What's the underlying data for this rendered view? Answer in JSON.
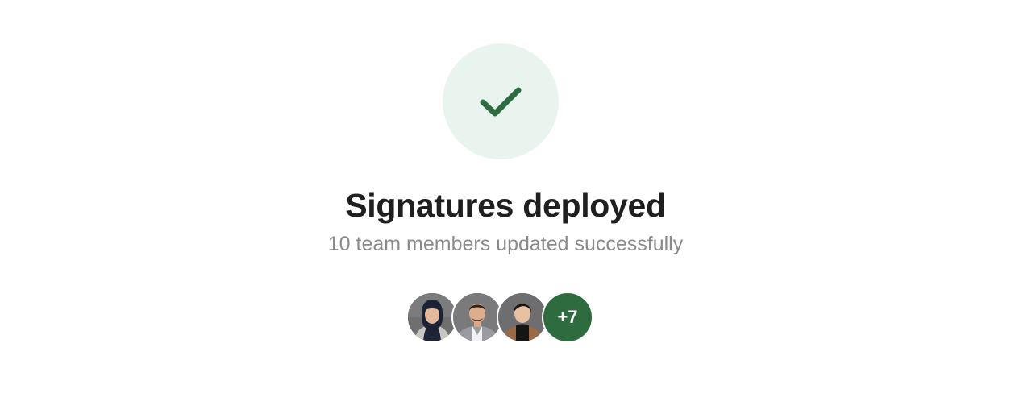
{
  "status": {
    "icon": "checkmark-icon",
    "accent_color": "#2e6b3f",
    "icon_bg_color": "#eaf4ee"
  },
  "title": "Signatures deployed",
  "subtitle": "10 team members updated successfully",
  "team": {
    "avatars": [
      {
        "name": "team-member-avatar-1"
      },
      {
        "name": "team-member-avatar-2"
      },
      {
        "name": "team-member-avatar-3"
      }
    ],
    "overflow_label": "+7",
    "overflow_color": "#2e6b3f"
  }
}
